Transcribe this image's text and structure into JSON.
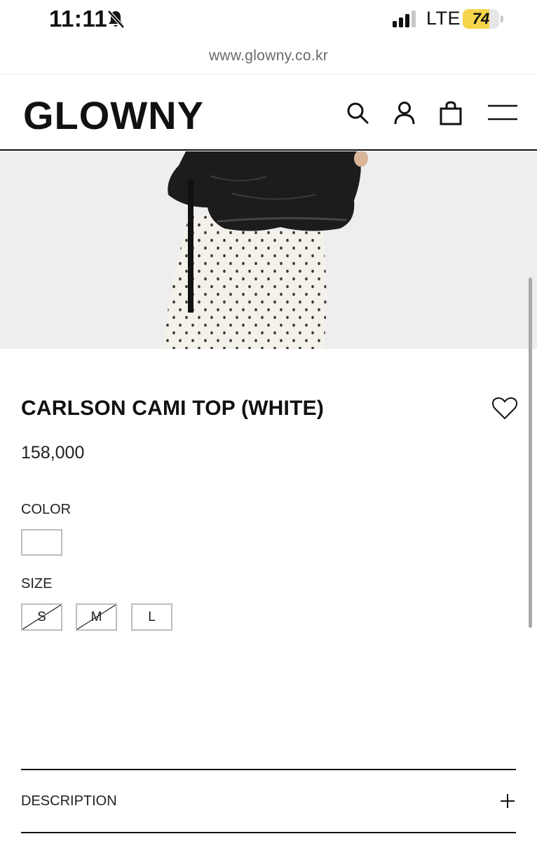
{
  "status_bar": {
    "time": "11:11",
    "network": "LTE",
    "battery_level": "74",
    "battery_fraction": 0.74,
    "icons": [
      "bell-slash-icon",
      "signal-bars-icon",
      "battery-icon"
    ]
  },
  "browser": {
    "url": "www.glowny.co.kr"
  },
  "header": {
    "logo": "GLOWNY",
    "icons": [
      "search-icon",
      "user-icon",
      "shopping-bag-icon",
      "hamburger-menu-icon"
    ]
  },
  "product": {
    "title": "CARLSON CAMI TOP (WHITE)",
    "price": "158,000",
    "wishlist_icon": "heart-outline-icon"
  },
  "options": {
    "color_label": "COLOR",
    "color_swatch": "#ffffff",
    "size_label": "SIZE",
    "sizes": [
      {
        "label": "S",
        "sold_out": true
      },
      {
        "label": "M",
        "sold_out": true
      },
      {
        "label": "L",
        "sold_out": false
      }
    ]
  },
  "accordion": {
    "description_label": "DESCRIPTION",
    "toggle_icon": "plus-icon"
  },
  "colors": {
    "text": "#111111",
    "border": "#bdbdbd",
    "battery_charging": "#f6d54a"
  }
}
